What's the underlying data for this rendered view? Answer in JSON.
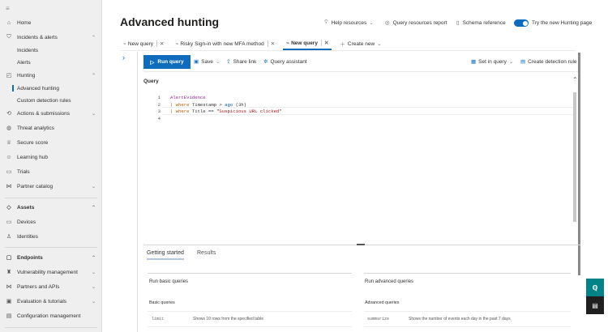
{
  "sidebar": {
    "items": [
      {
        "label": "Home",
        "icon": "home-icon"
      },
      {
        "label": "Incidents & alerts",
        "icon": "shield-icon",
        "chev": "^"
      },
      {
        "label": "Incidents"
      },
      {
        "label": "Alerts"
      },
      {
        "label": "Hunting",
        "icon": "hunting-icon",
        "chev": "^"
      },
      {
        "label": "Advanced hunting",
        "active": true
      },
      {
        "label": "Custom detection rules"
      },
      {
        "label": "Actions & submissions",
        "icon": "actions-icon",
        "chev": "v"
      },
      {
        "label": "Threat analytics",
        "icon": "threat-icon"
      },
      {
        "label": "Secure score",
        "icon": "trophy-icon"
      },
      {
        "label": "Learning hub",
        "icon": "learning-icon"
      },
      {
        "label": "Trials",
        "icon": "gift-icon"
      },
      {
        "label": "Partner catalog",
        "icon": "share-icon",
        "chev": "v"
      },
      {
        "label": "Assets",
        "icon": "assets-icon",
        "chev": "^",
        "bold": true
      },
      {
        "label": "Devices",
        "icon": "laptop-icon"
      },
      {
        "label": "Identities",
        "icon": "person-icon"
      },
      {
        "label": "Endpoints",
        "icon": "endpoints-icon",
        "chev": "^",
        "bold": true
      },
      {
        "label": "Vulnerability management",
        "icon": "vuln-icon",
        "chev": "v"
      },
      {
        "label": "Partners and APIs",
        "icon": "share-icon",
        "chev": "v"
      },
      {
        "label": "Evaluation & tutorials",
        "icon": "eval-icon",
        "chev": "v"
      },
      {
        "label": "Configuration management",
        "icon": "config-icon"
      }
    ]
  },
  "header": {
    "title": "Advanced hunting",
    "help": "Help resources",
    "report": "Query resources report",
    "schema": "Schema reference",
    "toggle": "Try the new Hunting page"
  },
  "tabs": [
    {
      "label": "New query"
    },
    {
      "label": "Risky Sign-in with new MFA method"
    },
    {
      "label": "New query",
      "active": true
    }
  ],
  "create_new": "Create new",
  "toolbar": {
    "run": "Run query",
    "save": "Save",
    "share": "Share link",
    "assistant": "Query assistant",
    "set_in_query": "Set in query",
    "create_rule": "Create detection rule"
  },
  "query": {
    "label": "Query",
    "lines": [
      "1",
      "2",
      "3",
      "4"
    ],
    "l1": "AlertEvidence",
    "l2a": "| where ",
    "l2b": "Timestamp > ",
    "l2c": "ago",
    "l2d": " (3h)",
    "l3a": "| where ",
    "l3b": "Title == ",
    "l3c": "\"Suspicious URL clicked\""
  },
  "bottom": {
    "tabs": [
      "Getting started",
      "Results"
    ],
    "basic": {
      "title": "Run basic queries",
      "sub": "Basic queries",
      "cmd": "limit",
      "desc": "Shows 10 rows from the specified table"
    },
    "advanced": {
      "title": "Run advanced queries",
      "sub": "Advanced queries",
      "cmd": "summarize",
      "desc": "Shows the number of events each day in the past 7 days"
    }
  }
}
